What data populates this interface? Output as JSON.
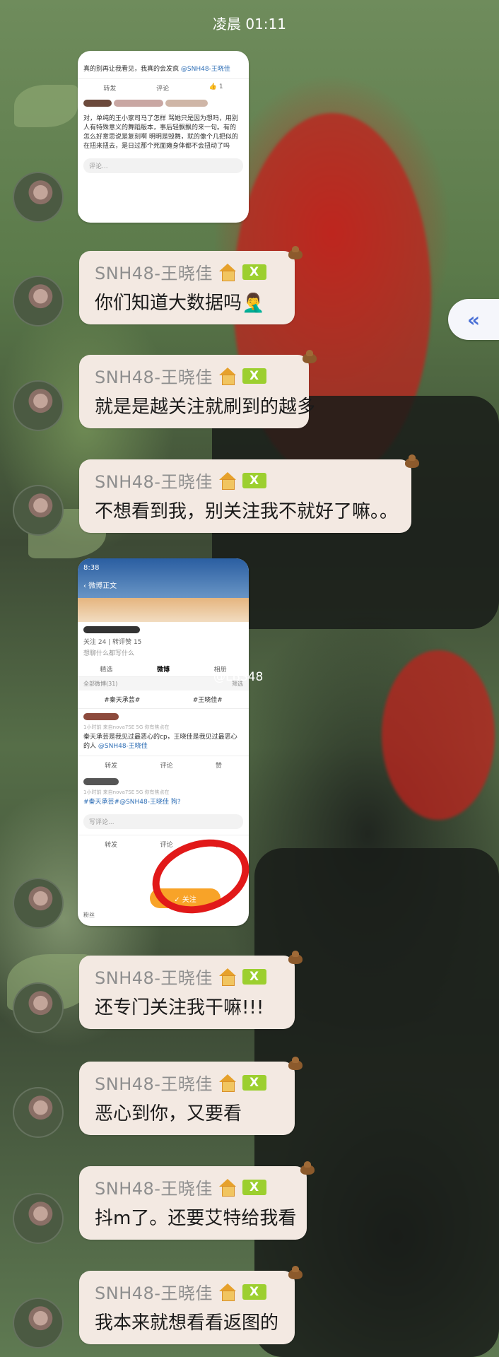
{
  "status_time": "凌晨 01:11",
  "watermark": "@LBS48",
  "image1": {
    "post1_text": "真的别再让我看见，我真的会发疯",
    "post1_mention": "@SNH48-王晓佳",
    "repost": "转发",
    "comment": "评论",
    "like_count": "1",
    "post2_text": "对，单纯的王小家司马了怎样 骂她只是因为想吗，用别人有特殊意义的舞蹈版本，事后轻飘飘的来一句。有的 怎么好意思说是复刻啊 明明是毁舞，就的像个几把似的在扭来扭去，是日过那个死面瘫身体都不会扭动了吗",
    "comment_placeholder": "评论..."
  },
  "image2": {
    "phone_time": "8:38",
    "back_label": "微博正文",
    "follow_stats": "关注 24",
    "fans_stats": "转评赞 15",
    "say_hint": "想聊什么都写什么",
    "tabs": [
      "精选",
      "微博",
      "相册"
    ],
    "all_weibo": "全部微博(31)",
    "filter": "筛选",
    "tag1": "#秦天承芸#",
    "tag2": "#王晓佳#",
    "post_meta": "1小时前  来自nova7SE 5G 你有焦点在",
    "post_text": "秦天承芸是我见过最恶心的cp，王晓佳是我见过最恶心的人",
    "post_mention": "@SNH48-王晓佳",
    "repost": "转发",
    "comment": "评论",
    "like": "赞",
    "post2_meta": "1小时前  来自nova7SE 5G 你有焦点在",
    "post2_text": "#秦天承芸#@SNH48-王晓佳 狗?",
    "write_comment": "写评论...",
    "bottom_left": "粉丝",
    "follow_button": "✓ 关注"
  },
  "sender": "SNH48-王晓佳",
  "badge": "X",
  "messages": [
    "你们知道大数据吗🤦‍♂️",
    "就是是越关注就刷到的越多",
    "不想看到我，别关注我不就好了嘛。。",
    "还专门关注我干嘛!!!",
    "恶心到你，又要看",
    "抖m了。还要艾特给我看",
    "我本来就想看看返图的"
  ],
  "side_button": "«",
  "colors": {
    "bubble": "#f3e9e2",
    "badge": "#9ccf2f",
    "follow": "#f8a328",
    "link": "#2f6fb6",
    "ring": "#e11919"
  }
}
